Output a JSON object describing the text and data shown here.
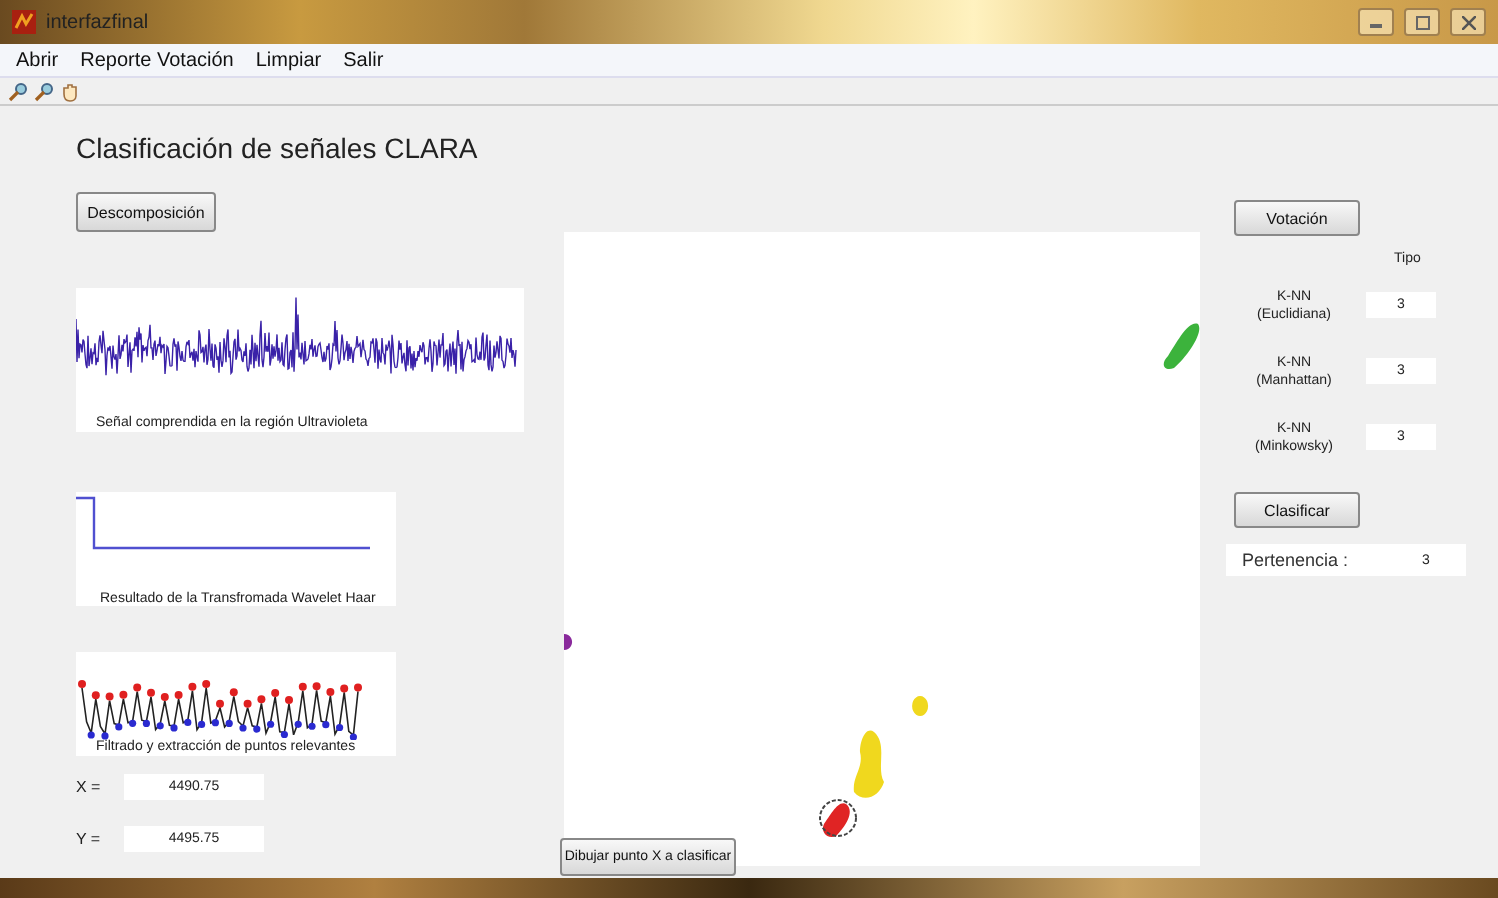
{
  "window": {
    "title": "interfazfinal"
  },
  "menu": [
    "Abrir",
    "Reporte Votación",
    "Limpiar",
    "Salir"
  ],
  "heading": "Clasificación de señales CLARA",
  "left_panel": {
    "decompose_button": "Descomposición",
    "plots": [
      {
        "kind": "signal",
        "caption": "Señal comprendida en la región Ultravioleta"
      },
      {
        "kind": "step",
        "caption": "Resultado de la Transfromada Wavelet Haar"
      },
      {
        "kind": "peaks",
        "caption": "Filtrado y extracción de puntos relevantes"
      }
    ],
    "coords": [
      {
        "label": "X =",
        "value": "4490.75"
      },
      {
        "label": "Y =",
        "value": "4495.75"
      }
    ]
  },
  "scatter": {
    "button": "Dibujar punto X a clasificar",
    "clusters": [
      {
        "color": "#8a2a9c"
      },
      {
        "color": "#3cb33c"
      },
      {
        "color": "#f0d81e"
      },
      {
        "color": "#e02424"
      }
    ]
  },
  "right_panel": {
    "vote_button": "Votación",
    "column_header": "Tipo",
    "classifiers": [
      {
        "name": "K-NN",
        "metric": "(Euclidiana)",
        "value": "3"
      },
      {
        "name": "K-NN",
        "metric": "(Manhattan)",
        "value": "3"
      },
      {
        "name": "K-NN",
        "metric": "(Minkowsky)",
        "value": "3"
      }
    ],
    "classify_button": "Clasificar",
    "membership": {
      "label": "Pertenencia :",
      "value": "3"
    }
  }
}
